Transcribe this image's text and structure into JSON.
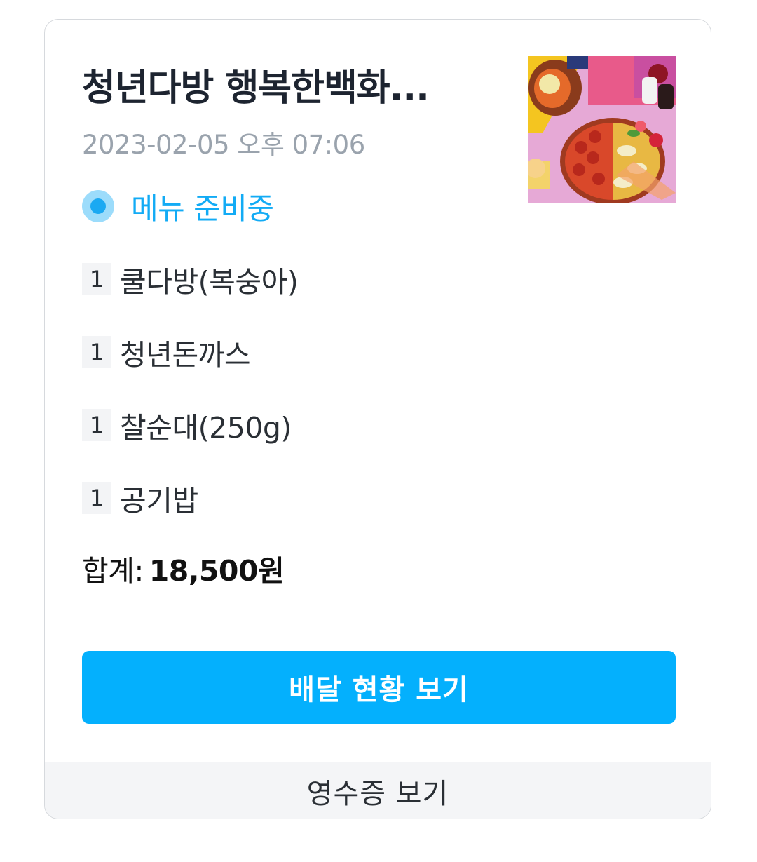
{
  "order": {
    "store_name": "청년다방 행복한백화...",
    "order_time": "2023-02-05 오후 07:06",
    "thumbnail_icon": "food-photo",
    "status": {
      "label": "메뉴 준비중",
      "color": "#12abf5",
      "icon": "status-dot-icon"
    },
    "items": [
      {
        "qty": "1",
        "name": "쿨다방(복숭아)"
      },
      {
        "qty": "1",
        "name": "청년돈까스"
      },
      {
        "qty": "1",
        "name": "찰순대(250g)"
      },
      {
        "qty": "1",
        "name": "공기밥"
      }
    ],
    "total_label": "합계:",
    "total_value": "18,500원"
  },
  "actions": {
    "delivery_status_label": "배달 현황 보기",
    "delivery_status_color": "#04b0fd",
    "receipt_label": "영수증 보기"
  }
}
